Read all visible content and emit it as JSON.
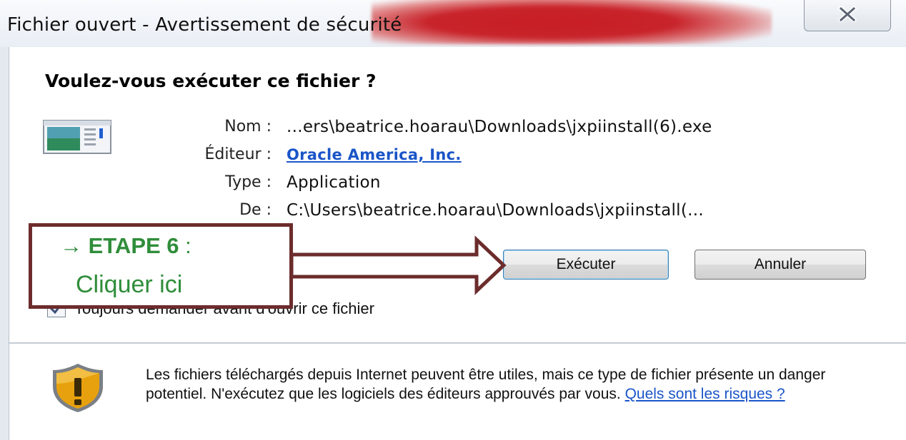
{
  "window": {
    "title": "Fichier ouvert - Avertissement de sécurité",
    "close_glyph": "✕"
  },
  "dialog": {
    "heading": "Voulez-vous exécuter ce fichier ?",
    "icon": "application-window-icon",
    "fields": [
      {
        "label": "Nom :",
        "value": "...ers\\beatrice.hoarau\\Downloads\\jxpiinstall(6).exe"
      },
      {
        "label": "Éditeur :",
        "value": "Oracle America, Inc."
      },
      {
        "label": "Type :",
        "value": "Application"
      },
      {
        "label": "De :",
        "value": "C:\\Users\\beatrice.hoarau\\Downloads\\jxpiinstall(..."
      }
    ],
    "buttons": {
      "run": "Exécuter",
      "cancel": "Annuler"
    },
    "checkbox": {
      "label": "Toujours demander avant d'ouvrir ce fichier",
      "checked": true
    },
    "warning": {
      "text": "Les fichiers téléchargés depuis Internet peuvent être utiles, mais ce type de fichier présente un danger potentiel. N'exécutez que les logiciels des éditeurs approuvés par vous.",
      "link": "Quels sont les risques ?"
    }
  },
  "annotation": {
    "arrow_glyph": "→",
    "step": "ETAPE 6",
    "colon": " :",
    "instruction": "Cliquer ici",
    "text_color": "#2f8d3a",
    "border_color": "#6c2c2c"
  },
  "colors": {
    "link": "#1a55c8",
    "title_glow": "#c81d25",
    "shield": "#e8a10e"
  }
}
